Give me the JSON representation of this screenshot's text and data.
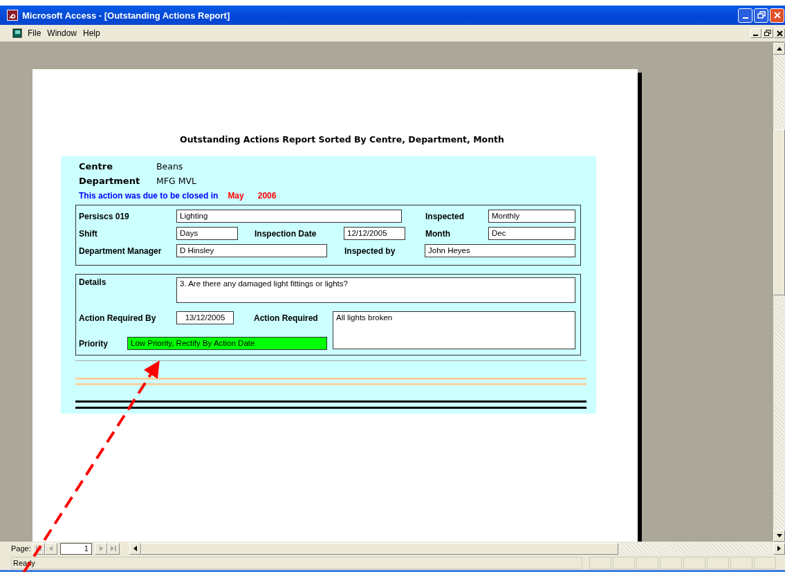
{
  "window": {
    "title": "Microsoft Access - [Outstanding Actions Report]"
  },
  "menu": [
    "File",
    "Window",
    "Help"
  ],
  "report": {
    "title": "Outstanding Actions Report  Sorted By Centre, Department, Month",
    "header": [
      {
        "label": "Centre",
        "value": "Beans"
      },
      {
        "label": "Department",
        "value": "MFG MVL"
      }
    ],
    "due": {
      "text": "This action was due to be closed in",
      "month": "May",
      "year": "2006"
    },
    "inspection_rows": [
      [
        {
          "label": "Persiscs 019",
          "value": "Lighting"
        },
        {
          "label": "Inspected",
          "value": "Monthly"
        }
      ],
      [
        {
          "label": "Shift",
          "value": "Days"
        },
        {
          "label": "Inspection Date",
          "value": "12/12/2005"
        },
        {
          "label": "Month",
          "value": "Dec"
        }
      ],
      [
        {
          "label": "Department Manager",
          "value": "D Hinsley"
        },
        {
          "label": "Inspected by",
          "value": "John Heyes"
        }
      ]
    ],
    "details": {
      "label": "Details",
      "value": "3. Are there any damaged light fittings or lights?"
    },
    "action_required_by": {
      "label": "Action Required By",
      "value": "13/12/2005"
    },
    "action_required": {
      "label": "Action Required",
      "value": "All lights broken"
    },
    "priority": {
      "label": "Priority",
      "value": "Low Priority, Rectify By Action Date"
    }
  },
  "navigation": {
    "label": "Page:",
    "page": "1"
  },
  "status_bar": {
    "text": "Ready"
  }
}
